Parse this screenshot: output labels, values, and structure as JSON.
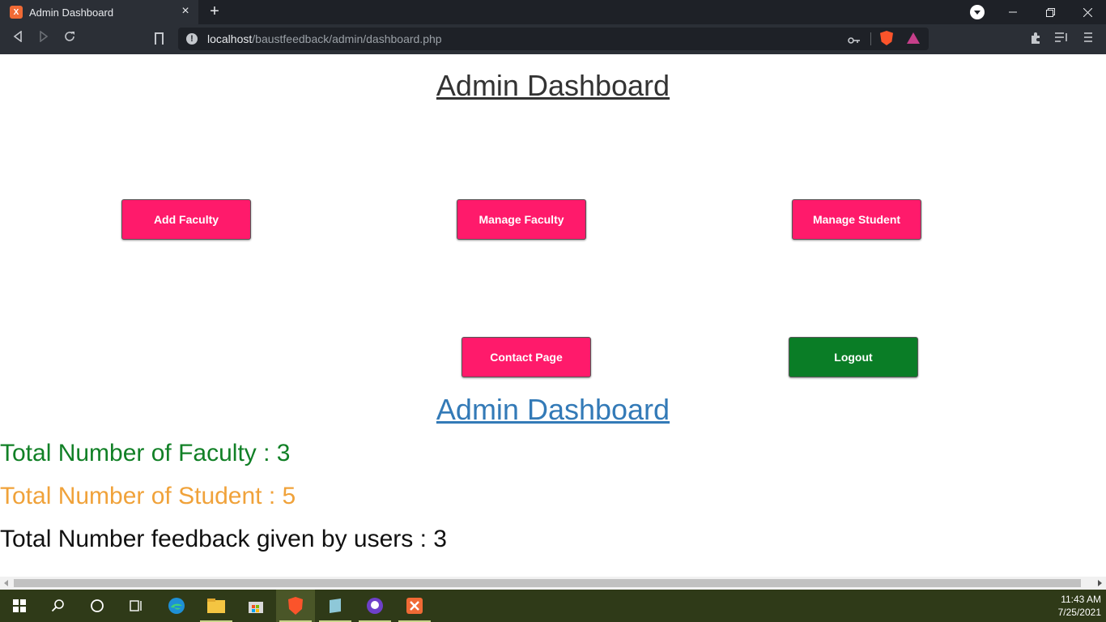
{
  "browser": {
    "tab_title": "Admin Dashboard",
    "favicon_glyph": "X",
    "new_tab_label": "+",
    "url_host": "localhost",
    "url_path": "/baustfeedback/admin/dashboard.php",
    "accent": "#fb542b"
  },
  "page": {
    "title": "Admin Dashboard",
    "buttons": {
      "add_faculty": "Add Faculty",
      "manage_faculty": "Manage Faculty",
      "manage_student": "Manage Student",
      "contact_page": "Contact Page",
      "logout": "Logout"
    },
    "dashboard_link": "Admin Dashboard",
    "stats": {
      "faculty": "Total Number of Faculty : 3",
      "student": "Total Number of Student : 5",
      "feedback": "Total Number feedback given by users : 3"
    },
    "colors": {
      "primary_button": "#ff1a6b",
      "logout_button": "#0a7d26",
      "faculty_stat": "#118026",
      "student_stat": "#f0a23a"
    }
  },
  "taskbar": {
    "time": "11:43 AM",
    "date": "7/25/2021",
    "apps": [
      "start-icon",
      "search-icon",
      "cortana-icon",
      "task-view-icon",
      "edge-icon",
      "file-explorer-icon",
      "store-icon",
      "brave-icon",
      "notepad-icon",
      "github-icon",
      "xampp-icon"
    ]
  }
}
